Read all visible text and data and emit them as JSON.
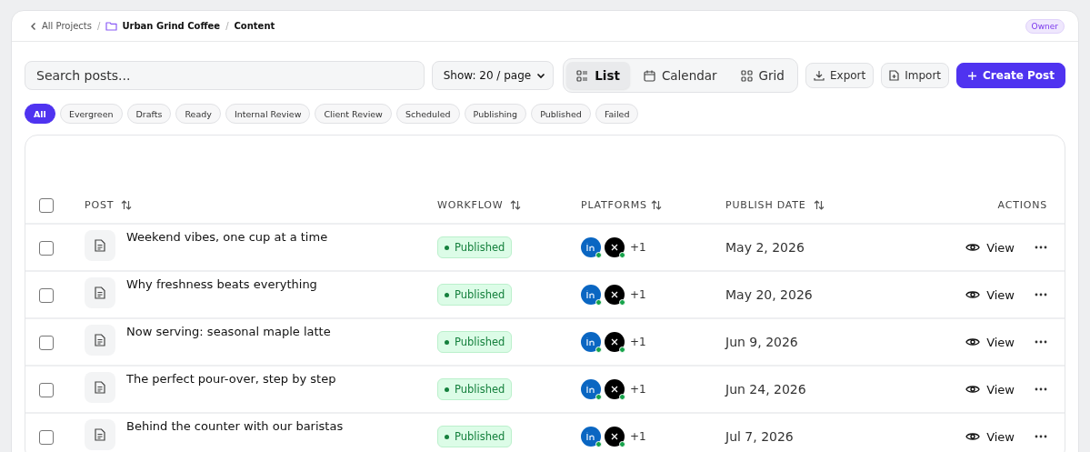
{
  "breadcrumb": {
    "back": "All Projects",
    "project": "Urban Grind Coffee",
    "current": "Content",
    "separator": "/"
  },
  "role_badge": "Owner",
  "search": {
    "placeholder": "Search posts..."
  },
  "page_size": "Show: 20 / page",
  "views": [
    {
      "label": "List",
      "kind": "list",
      "selected": true
    },
    {
      "label": "Calendar",
      "kind": "calendar",
      "selected": false
    },
    {
      "label": "Grid",
      "kind": "grid",
      "selected": false
    }
  ],
  "export_button": "Export",
  "import_button": "Import",
  "create_button": "Create Post",
  "filters": [
    {
      "label": "All",
      "selected": true
    },
    {
      "label": "Evergreen",
      "selected": false
    },
    {
      "label": "Drafts",
      "selected": false
    },
    {
      "label": "Ready",
      "selected": false
    },
    {
      "label": "Internal Review",
      "selected": false
    },
    {
      "label": "Client Review",
      "selected": false
    },
    {
      "label": "Scheduled",
      "selected": false
    },
    {
      "label": "Publishing",
      "selected": false
    },
    {
      "label": "Published",
      "selected": false
    },
    {
      "label": "Failed",
      "selected": false
    }
  ],
  "table": {
    "select_all_checked": false,
    "columns": [
      {
        "label": "POST",
        "sortable": true
      },
      {
        "label": "WORKFLOW",
        "sortable": true
      },
      {
        "label": "PLATFORMS",
        "sortable": true
      },
      {
        "label": "PUBLISH DATE",
        "sortable": true
      },
      {
        "label": "ACTIONS",
        "sortable": false
      }
    ],
    "rows": [
      {
        "checked": false,
        "title": "Weekend vibes, one cup at a time",
        "status": "Published",
        "platforms": [
          {
            "kind": "linkedin",
            "connected": true
          },
          {
            "kind": "x",
            "connected": true
          }
        ],
        "more_platforms": "+1",
        "date": "May 2, 2026",
        "view": "View"
      },
      {
        "checked": false,
        "title": "Why freshness beats everything",
        "status": "Published",
        "platforms": [
          {
            "kind": "linkedin",
            "connected": true
          },
          {
            "kind": "x",
            "connected": true
          }
        ],
        "more_platforms": "+1",
        "date": "May 20, 2026",
        "view": "View"
      },
      {
        "checked": false,
        "title": "Now serving: seasonal maple latte",
        "status": "Published",
        "platforms": [
          {
            "kind": "linkedin",
            "connected": true
          },
          {
            "kind": "x",
            "connected": true
          }
        ],
        "more_platforms": "+1",
        "date": "Jun 9, 2026",
        "view": "View"
      },
      {
        "checked": false,
        "title": "The perfect pour-over, step by step",
        "status": "Published",
        "platforms": [
          {
            "kind": "linkedin",
            "connected": true
          },
          {
            "kind": "x",
            "connected": true
          }
        ],
        "more_platforms": "+1",
        "date": "Jun 24, 2026",
        "view": "View"
      },
      {
        "checked": false,
        "title": "Behind the counter with our baristas",
        "status": "Published",
        "platforms": [
          {
            "kind": "linkedin",
            "connected": true
          },
          {
            "kind": "x",
            "connected": true
          }
        ],
        "more_platforms": "+1",
        "date": "Jul 7, 2026",
        "view": "View"
      }
    ]
  }
}
